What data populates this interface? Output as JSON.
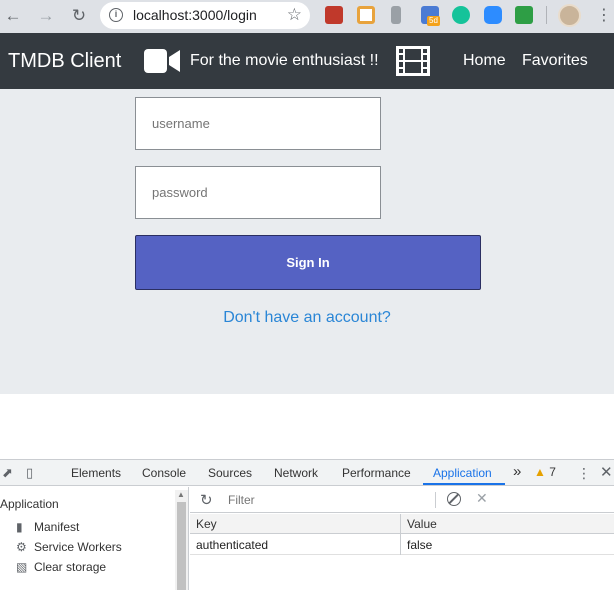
{
  "browser": {
    "url": "localhost:3000/login",
    "extension_badge": "5d"
  },
  "navbar": {
    "brand": "TMDB Client",
    "tagline": "For the movie enthusiast !!",
    "links": [
      "Home",
      "Favorites"
    ]
  },
  "login": {
    "username_placeholder": "username",
    "password_placeholder": "password",
    "sign_in_label": "Sign In",
    "signup_link": "Don't have an account?"
  },
  "devtools": {
    "tabs": [
      "Elements",
      "Console",
      "Sources",
      "Network",
      "Performance",
      "Application"
    ],
    "active_tab": "Application",
    "more_tabs": "»",
    "warning_count": "7",
    "sidebar": {
      "heading": "Application",
      "items": [
        "Manifest",
        "Service Workers",
        "Clear storage"
      ]
    },
    "filter_placeholder": "Filter",
    "table": {
      "headers": [
        "Key",
        "Value"
      ],
      "rows": [
        [
          "authenticated",
          "false"
        ]
      ]
    }
  },
  "colors": {
    "navbar_bg": "#343a40",
    "content_bg": "#e9ecef",
    "button_bg": "#5562c3",
    "link": "#2a86d6",
    "devtools_accent": "#1a73e8"
  }
}
